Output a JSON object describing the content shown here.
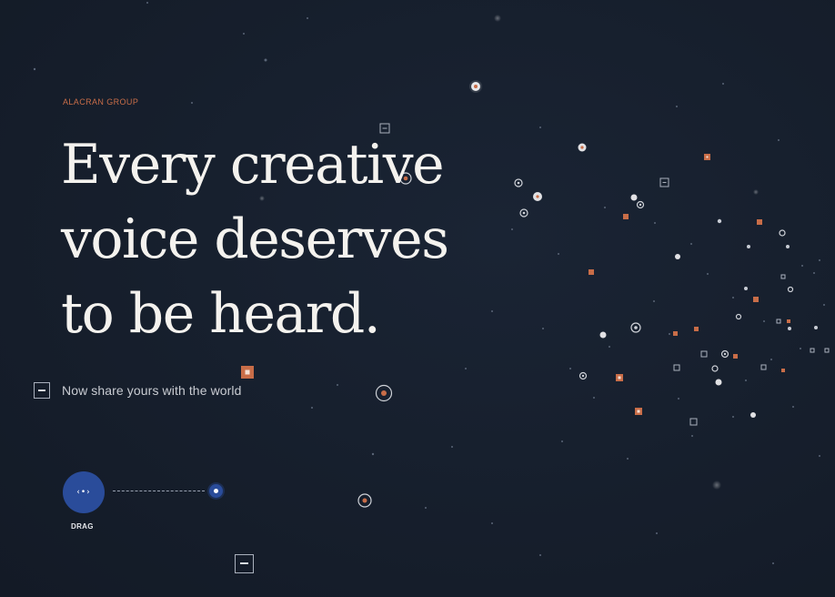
{
  "brand": {
    "name": "ALACRAN GROUP"
  },
  "hero": {
    "headline_lines": [
      "Every creative",
      "voice deserves",
      "to be heard."
    ],
    "subtitle": "Now share yours with the world"
  },
  "drag": {
    "glyph": "‹•›",
    "label": "DRAG"
  },
  "icons": {
    "collapse": "minus-square-icon",
    "drag_handle": "drag-arrows-icon",
    "drag_target": "target-dot-icon",
    "bottom_toggle": "minus-square-icon"
  },
  "colors": {
    "background": "#161f2d",
    "accent_orange": "#c86d48",
    "accent_blue": "#2a4c9a",
    "text_primary": "#f4f2ee",
    "text_secondary": "#c9ccd2"
  }
}
